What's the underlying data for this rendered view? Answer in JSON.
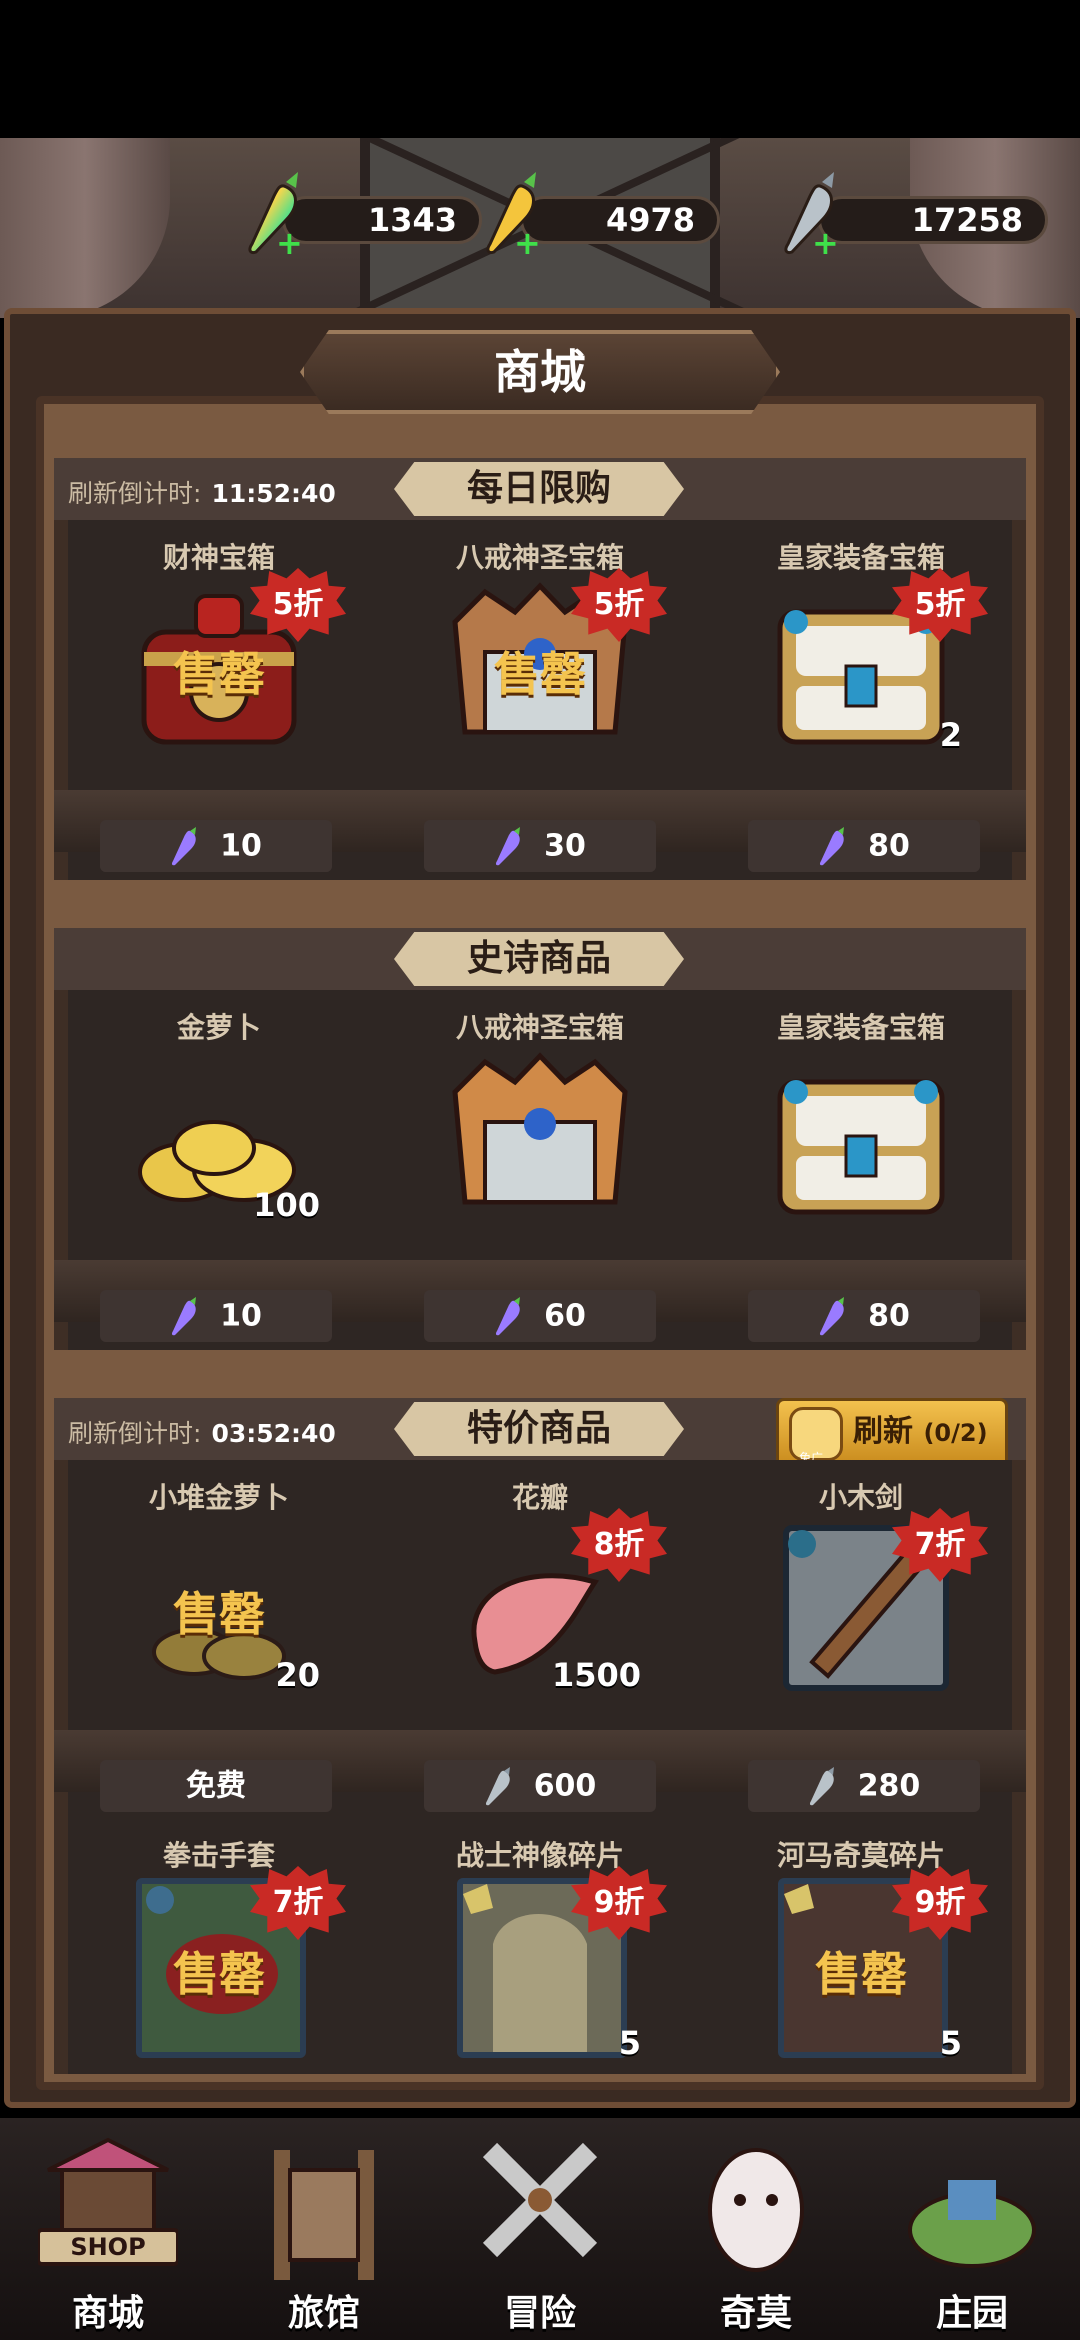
{
  "currencies": [
    {
      "amount": "1343",
      "icon": "rainbow-carrot-icon"
    },
    {
      "amount": "4978",
      "icon": "gold-carrot-icon"
    },
    {
      "amount": "17258",
      "icon": "silver-carrot-icon"
    }
  ],
  "title": "商城",
  "sections": {
    "daily": {
      "title": "每日限购",
      "countdown_label": "刷新倒计时:",
      "countdown": "11:52:40",
      "items": [
        {
          "name": "财神宝箱",
          "discount": "5折",
          "sold": "售罄",
          "price": "10",
          "currency_icon": "rainbow-carrot-icon"
        },
        {
          "name": "八戒神圣宝箱",
          "discount": "5折",
          "sold": "售罄",
          "price": "30",
          "currency_icon": "rainbow-carrot-icon"
        },
        {
          "name": "皇家装备宝箱",
          "discount": "5折",
          "qty": "2",
          "price": "80",
          "currency_icon": "rainbow-carrot-icon"
        }
      ]
    },
    "epic": {
      "title": "史诗商品",
      "items": [
        {
          "name": "金萝卜",
          "qty": "100",
          "price": "10",
          "currency_icon": "rainbow-carrot-icon"
        },
        {
          "name": "八戒神圣宝箱",
          "price": "60",
          "currency_icon": "rainbow-carrot-icon"
        },
        {
          "name": "皇家装备宝箱",
          "price": "80",
          "currency_icon": "rainbow-carrot-icon"
        }
      ]
    },
    "special": {
      "title": "特价商品",
      "countdown_label": "刷新倒计时:",
      "countdown": "03:52:40",
      "refresh_label": "刷新",
      "refresh_count": "(0/2)",
      "ad_tag": "免广",
      "items": [
        {
          "name": "小堆金萝卜",
          "sold": "售罄",
          "qty": "20",
          "price": "免费"
        },
        {
          "name": "花瓣",
          "discount": "8折",
          "qty": "1500",
          "price": "600",
          "currency_icon": "silver-carrot-icon"
        },
        {
          "name": "小木剑",
          "discount": "7折",
          "price": "280",
          "currency_icon": "silver-carrot-icon"
        }
      ],
      "items2": [
        {
          "name": "拳击手套",
          "discount": "7折",
          "sold": "售罄"
        },
        {
          "name": "战士神像碎片",
          "discount": "9折",
          "qty": "5"
        },
        {
          "name": "河马奇莫碎片",
          "discount": "9折",
          "sold": "售罄",
          "qty": "5"
        }
      ]
    }
  },
  "nav": [
    {
      "label": "商城",
      "icon": "shop-icon",
      "sign": "SHOP"
    },
    {
      "label": "旅馆",
      "icon": "inn-gate-icon"
    },
    {
      "label": "冒险",
      "icon": "crossed-swords-icon"
    },
    {
      "label": "奇莫",
      "icon": "pet-icon"
    },
    {
      "label": "庄园",
      "icon": "manor-island-icon"
    }
  ],
  "colors": {
    "discount": "#c92a25",
    "sold_out": "#f4c44f",
    "refresh_button": "#f3c14e"
  }
}
